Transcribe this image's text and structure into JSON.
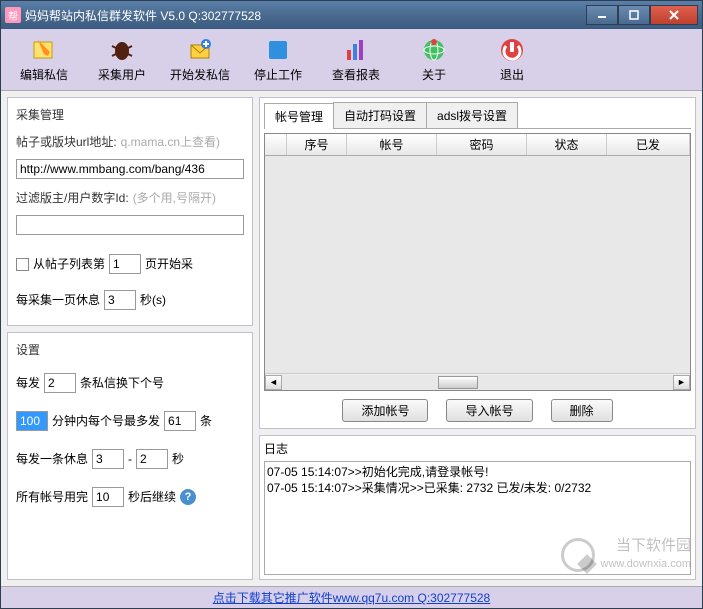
{
  "window": {
    "icon_text": "帮",
    "title": "妈妈帮站内私信群发软件 V5.0 Q:302777528"
  },
  "toolbar": [
    {
      "label": "编辑私信",
      "icon": "edit"
    },
    {
      "label": "采集用户",
      "icon": "bug"
    },
    {
      "label": "开始发私信",
      "icon": "send"
    },
    {
      "label": "停止工作",
      "icon": "stop"
    },
    {
      "label": "查看报表",
      "icon": "chart"
    },
    {
      "label": "关于",
      "icon": "globe"
    },
    {
      "label": "退出",
      "icon": "exit"
    }
  ],
  "collect": {
    "title": "采集管理",
    "url_label": "帖子或版块url地址:",
    "url_hint": "q.mama.cn上查看)",
    "url_value": "http://www.mmbang.com/bang/436",
    "filter_label": "过滤版主/用户数字Id:",
    "filter_hint": "(多个用,号隔开)",
    "filter_value": "",
    "startpage_prefix": "从帖子列表第",
    "startpage_value": "1",
    "startpage_suffix": "页开始采",
    "rest_prefix": "每采集一页休息",
    "rest_value": "3",
    "rest_suffix": "秒(s)"
  },
  "settings": {
    "title": "设置",
    "perswitch_prefix": "每发",
    "perswitch_value": "2",
    "perswitch_suffix": "条私信换下个号",
    "maxsend_min_value": "100",
    "maxsend_mid": "分钟内每个号最多发",
    "maxsend_value": "61",
    "maxsend_suffix": "条",
    "rest2_prefix": "每发一条休息",
    "rest2_from": "3",
    "rest2_dash": "-",
    "rest2_to": "2",
    "rest2_suffix": "秒",
    "allused_prefix": "所有帐号用完",
    "allused_value": "10",
    "allused_suffix": "秒后继续",
    "help": "?"
  },
  "tabs": [
    "帐号管理",
    "自动打码设置",
    "adsl拨号设置"
  ],
  "table": {
    "cols": [
      "",
      "序号",
      "帐号",
      "密码",
      "状态",
      "已发"
    ]
  },
  "buttons": {
    "add": "添加帐号",
    "import": "导入帐号",
    "delete": "删除"
  },
  "log": {
    "title": "日志",
    "lines": [
      "07-05 15:14:07>>初始化完成,请登录帐号!",
      "07-05 15:14:07>>采集情况>>已采集: 2732 已发/未发: 0/2732"
    ]
  },
  "footer": {
    "prefix": "点击下载其它推广软件",
    "link": "www.qq7u.com",
    "suffix": " Q:302777528"
  },
  "watermark": {
    "name": "当下软件园",
    "url": "www.downxia.com"
  }
}
